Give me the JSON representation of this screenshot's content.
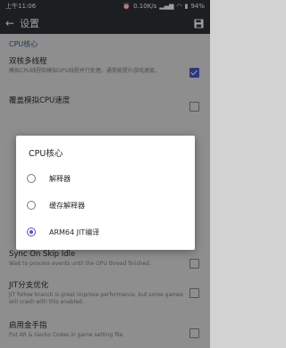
{
  "status": {
    "time": "上午11:06",
    "network": "0.10K/s",
    "battery": "94%",
    "icons": [
      "alarm-icon",
      "signal-icon",
      "wifi-icon",
      "battery-icon"
    ]
  },
  "appbar": {
    "title": "设置",
    "back_icon": "back-arrow-icon",
    "save_icon": "save-icon"
  },
  "settings": {
    "section_cpu": "CPU核心",
    "dual_core": {
      "title": "双核多线程",
      "desc": "模拟CPU线程和模拟GPU线程并行处理，通常能提升游戏速度。",
      "checked": true
    },
    "override_cpu": {
      "title": "覆盖模拟CPU速度",
      "desc": "",
      "checked": false
    },
    "sync_on_skip": {
      "title": "Sync On Skip Idle",
      "desc": "Wait to process events until the GPU thread finished.",
      "checked": false
    },
    "jit_branch": {
      "title": "JIT分支优化",
      "desc": "JIT follow branch is great improve performance, but some games will crash with this enabled.",
      "checked": false
    },
    "cheats": {
      "title": "启用金手指",
      "desc": "Put AR & Gecko Codes in game setting file.",
      "checked": false
    }
  },
  "dialog": {
    "title": "CPU核心",
    "options": [
      "解释器",
      "缓存解释器",
      "ARM64 JIT编译"
    ],
    "selected_index": 2
  },
  "colors": {
    "accent": "#5a4fcf",
    "appbar": "#2d3237",
    "section": "#2f5f7f"
  }
}
